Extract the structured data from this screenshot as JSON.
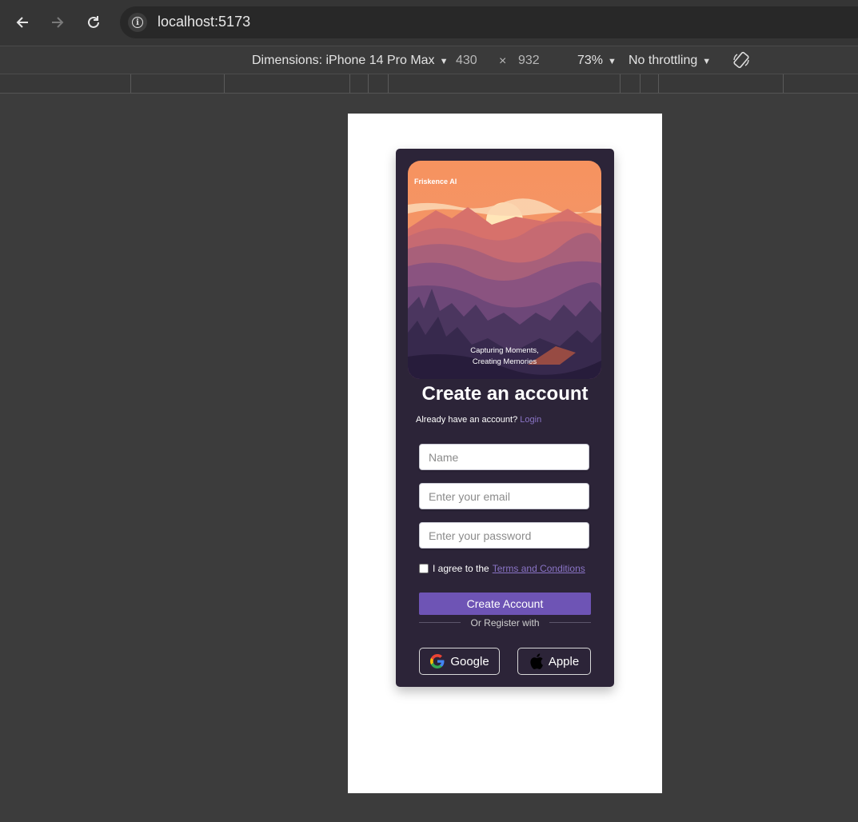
{
  "browser": {
    "url": "localhost:5173",
    "device": {
      "dimensions_label": "Dimensions: iPhone 14 Pro Max",
      "width": "430",
      "times": "×",
      "height": "932",
      "zoom": "73%",
      "throttling": "No throttling"
    }
  },
  "app": {
    "brand": "Friskence",
    "brand_suffix": "AI",
    "tagline_line1": "Capturing Moments,",
    "tagline_line2": "Creating Memories",
    "title": "Create an account",
    "login_prompt": "Already have an account?",
    "login_link": "Login",
    "fields": {
      "name_placeholder": "Name",
      "email_placeholder": "Enter your email",
      "password_placeholder": "Enter your password"
    },
    "agree_text": "I agree to the",
    "terms_link": "Terms and Conditions",
    "create_button": "Create Account",
    "or_register": "Or Register with",
    "google_label": "Google",
    "apple_label": "Apple"
  },
  "colors": {
    "card_bg": "#2c2438",
    "accent": "#6e54b5",
    "link": "#8a74c6"
  }
}
